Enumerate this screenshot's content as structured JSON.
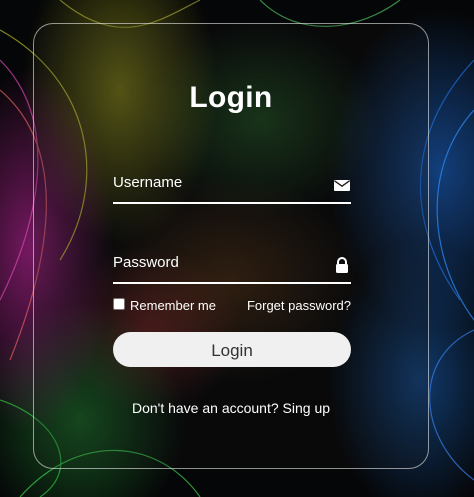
{
  "login_form": {
    "title": "Login",
    "username": {
      "label": "Username",
      "icon": "envelope-icon",
      "value": ""
    },
    "password": {
      "label": "Password",
      "icon": "lock-icon",
      "value": ""
    },
    "remember_label": "Remember me",
    "remember_checked": false,
    "forgot_label": "Forget password?",
    "submit_label": "Login",
    "signup_prompt": "Don't have an account?",
    "signup_link": "Sing up"
  },
  "colors": {
    "text": "#ffffff",
    "button_bg": "#f0f0f0",
    "button_text": "#333333",
    "card_border": "#bfbfbf"
  }
}
